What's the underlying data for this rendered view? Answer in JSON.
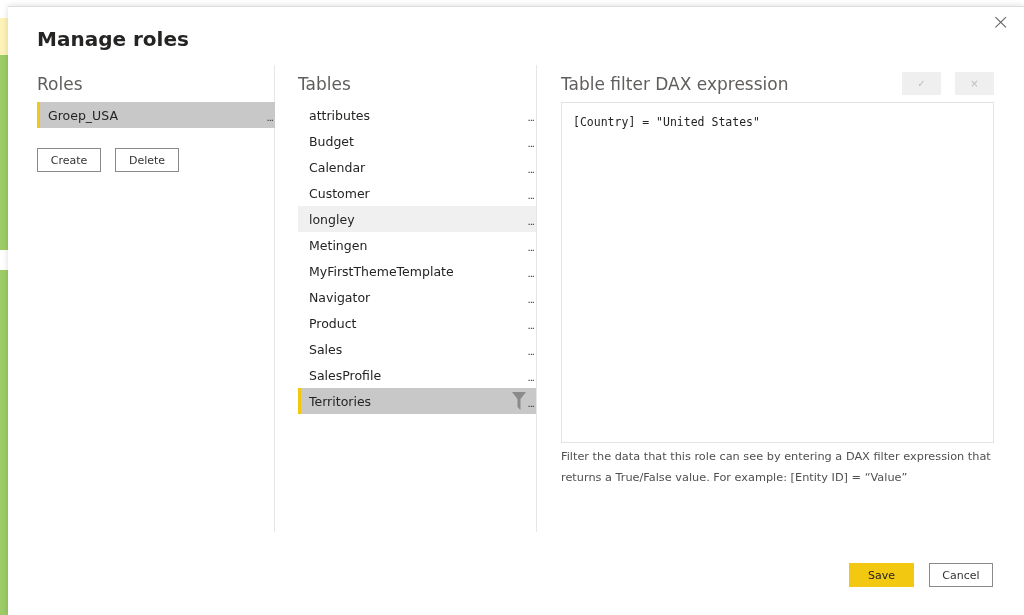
{
  "dialog": {
    "title": "Manage roles",
    "close": "×"
  },
  "roles": {
    "heading": "Roles",
    "items": [
      {
        "label": "Groep_USA",
        "more": "...",
        "selected": true
      }
    ],
    "buttons": [
      "Create",
      "Delete"
    ]
  },
  "tables": {
    "heading": "Tables",
    "items": [
      {
        "label": "attributes",
        "more": "...",
        "selected": false,
        "hovered": false,
        "filtered": false
      },
      {
        "label": "Budget",
        "more": "...",
        "selected": false,
        "hovered": false,
        "filtered": false
      },
      {
        "label": "Calendar",
        "more": "...",
        "selected": false,
        "hovered": false,
        "filtered": false
      },
      {
        "label": "Customer",
        "more": "...",
        "selected": false,
        "hovered": false,
        "filtered": false
      },
      {
        "label": "longley",
        "more": "...",
        "selected": false,
        "hovered": true,
        "filtered": false
      },
      {
        "label": "Metingen",
        "more": "...",
        "selected": false,
        "hovered": false,
        "filtered": false
      },
      {
        "label": "MyFirstThemeTemplate",
        "more": "...",
        "selected": false,
        "hovered": false,
        "filtered": false
      },
      {
        "label": "Navigator",
        "more": "...",
        "selected": false,
        "hovered": false,
        "filtered": false
      },
      {
        "label": "Product",
        "more": "...",
        "selected": false,
        "hovered": false,
        "filtered": false
      },
      {
        "label": "Sales",
        "more": "...",
        "selected": false,
        "hovered": false,
        "filtered": false
      },
      {
        "label": "SalesProfile",
        "more": "...",
        "selected": false,
        "hovered": false,
        "filtered": false
      },
      {
        "label": "Territories",
        "more": "...",
        "selected": true,
        "hovered": false,
        "filtered": true
      }
    ]
  },
  "dax": {
    "heading": "Table filter DAX expression",
    "confirm": {
      "label": "✓",
      "disabled": true
    },
    "discard": {
      "label": "×",
      "disabled": true
    },
    "expression": "[Country] = \"United States\"",
    "help": "Filter the data that this role can see by entering a DAX filter expression that returns a True/False value. For example: [Entity ID] = “Value”"
  },
  "footer": {
    "save": "Save",
    "cancel": "Cancel"
  }
}
